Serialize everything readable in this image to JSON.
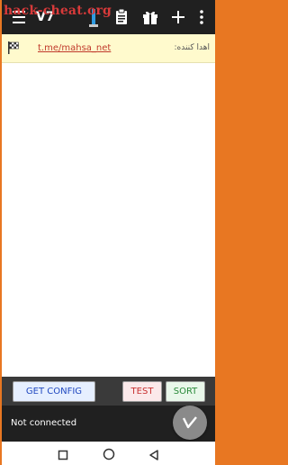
{
  "watermark": "hack-cheat.org",
  "appbar": {
    "title": "V7",
    "icons": [
      "menu-icon",
      "flag-tab-icon",
      "clipboard-icon",
      "gift-icon",
      "add-icon",
      "more-vert-icon"
    ]
  },
  "banner": {
    "link": "t.me/mahsa_net",
    "label": "اهدا کننده:",
    "icon": "checkered-flag-icon"
  },
  "actions": {
    "get_config": "GET CONFIG",
    "test": "TEST",
    "sort": "SORT"
  },
  "status": {
    "text": "Not connected",
    "fab_icon": "v-logo-icon"
  },
  "navbar": {
    "icons": [
      "recents-icon",
      "home-icon",
      "back-icon"
    ]
  },
  "colors": {
    "frame": "#E87722",
    "appbar": "#202020",
    "banner": "#FFFACD",
    "link": "#c0392b"
  }
}
